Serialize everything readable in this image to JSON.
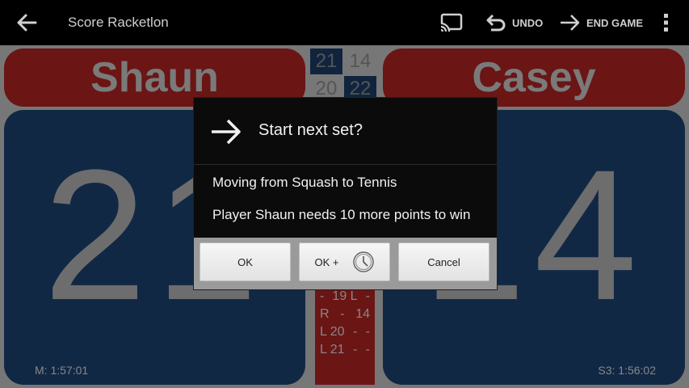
{
  "appbar": {
    "title": "Score Racketlon",
    "undo_label": "UNDO",
    "end_game_label": "END GAME"
  },
  "players": {
    "left": {
      "name": "Shaun",
      "score": "21",
      "timer": "M: 1:57:01"
    },
    "right": {
      "name": "Casey",
      "score": "14",
      "timer": "S3: 1:56:02"
    }
  },
  "set_scores": [
    [
      "21",
      "14"
    ],
    [
      "20",
      "22"
    ]
  ],
  "history": [
    [
      "-",
      "19 L",
      "-"
    ],
    [
      "R",
      "-",
      "14"
    ],
    [
      "L 20",
      "-",
      "-"
    ],
    [
      "L 21",
      "-",
      "-"
    ]
  ],
  "dialog": {
    "title": "Start next set?",
    "line1": "Moving from Squash to Tennis",
    "line2": "Player Shaun needs 10 more points to win",
    "ok_label": "OK",
    "ok_plus_label": "OK +",
    "cancel_label": "Cancel"
  },
  "colors": {
    "appbar_bg": "#000000",
    "name_red": "#6b1515",
    "panel_blue": "#112845",
    "dialog_bg": "#0b0b0b"
  },
  "icons": {
    "back": "arrow-left-icon",
    "cast": "cast-icon",
    "undo": "undo-icon",
    "end_game": "arrow-right-icon",
    "menu": "more-vert-icon",
    "dialog": "arrow-right-icon",
    "ok_plus": "clock-icon"
  }
}
